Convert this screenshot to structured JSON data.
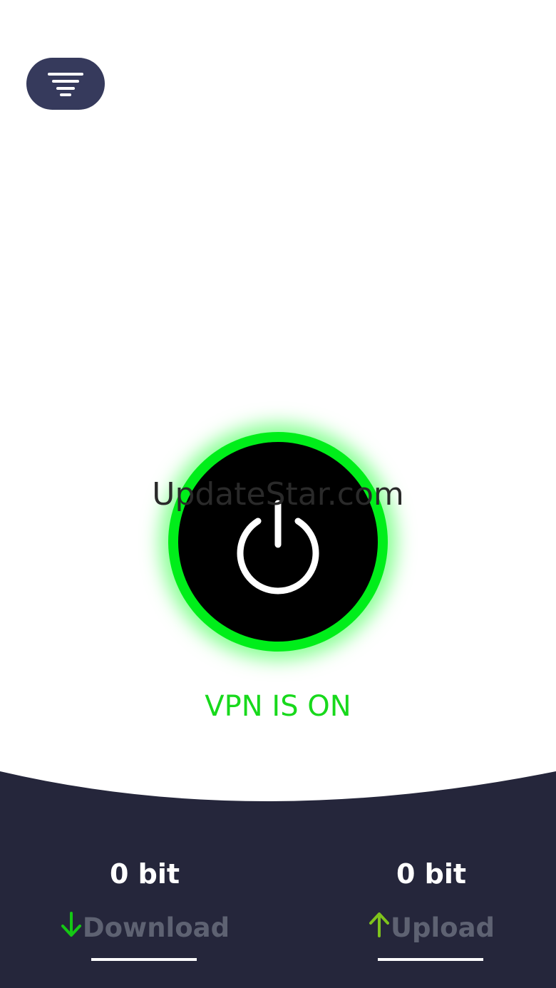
{
  "app": {
    "watermark": "UpdateStar.com"
  },
  "header": {
    "menu_icon": "filter-menu-icon"
  },
  "power": {
    "icon": "power-icon",
    "glow_color": "#00ee1a",
    "status_text": "VPN IS ON",
    "status_color": "#18d91c"
  },
  "stats": {
    "download": {
      "value": "0 bit",
      "label": "Download",
      "icon": "arrow-down-icon",
      "icon_color": "#14c814"
    },
    "upload": {
      "value": "0 bit",
      "label": "Upload",
      "icon": "arrow-up-icon",
      "icon_color": "#7fc31c"
    }
  },
  "colors": {
    "panel": "#25263b",
    "menu_button": "#363a5c",
    "label_gray": "#5e6272"
  }
}
